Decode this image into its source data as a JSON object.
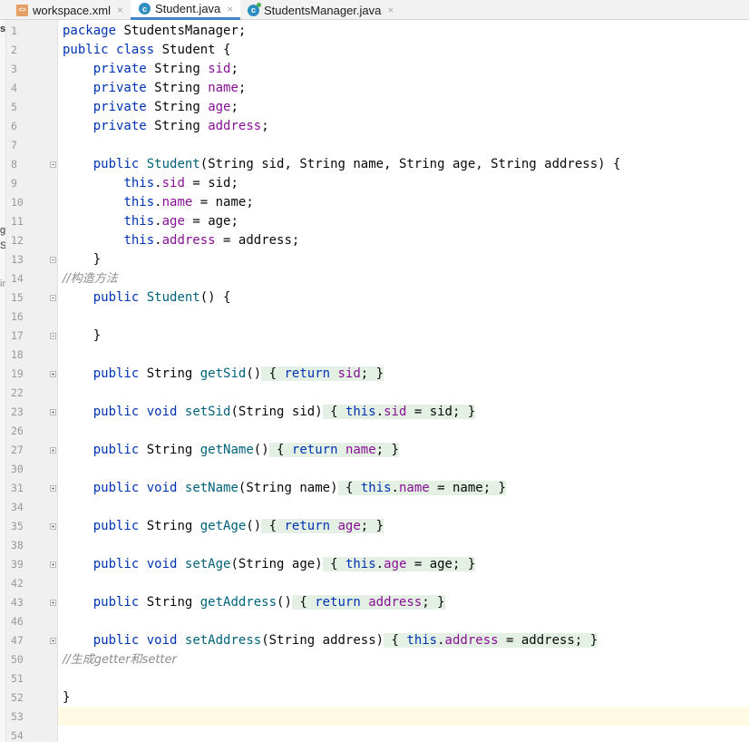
{
  "tabs": [
    {
      "label": "workspace.xml",
      "icon": "xml-file-icon",
      "active": false
    },
    {
      "label": "Student.java",
      "icon": "java-class-icon",
      "active": true
    },
    {
      "label": "StudentsManager.java",
      "icon": "java-class-icon",
      "active": false
    }
  ],
  "close_glyph": "×",
  "left_fragments": [
    "s",
    "ge",
    "Sy",
    "in"
  ],
  "code": {
    "pkg_kw": "package",
    "pkg_name": "StudentsManager;",
    "public": "public",
    "private": "private",
    "class_kw": "class",
    "void_kw": "void",
    "return_kw": "return",
    "this_kw": "this",
    "string_type": "String",
    "class_name": "Student",
    "fields": [
      "sid",
      "name",
      "age",
      "address"
    ],
    "comment_constructor": "//构造方法",
    "comment_getset": "//生成getter和setter",
    "methods": {
      "getSid": "getSid",
      "setSid": "setSid",
      "getName": "getName",
      "setName": "setName",
      "getAge": "getAge",
      "setAge": "setAge",
      "getAddress": "getAddress",
      "setAddress": "setAddress"
    }
  },
  "line_numbers": [
    "1",
    "2",
    "3",
    "4",
    "5",
    "6",
    "7",
    "8",
    "9",
    "10",
    "11",
    "12",
    "13",
    "14",
    "15",
    "16",
    "17",
    "18",
    "19",
    "22",
    "23",
    "26",
    "27",
    "30",
    "31",
    "34",
    "35",
    "38",
    "39",
    "42",
    "43",
    "46",
    "47",
    "50",
    "51",
    "52",
    "53",
    "54"
  ],
  "colors": {
    "keyword": "#0033b3",
    "field": "#871094",
    "method": "#00627a",
    "comment": "#8c8c8c",
    "caret_line": "#fffae3",
    "tab_underline": "#4083c9"
  }
}
